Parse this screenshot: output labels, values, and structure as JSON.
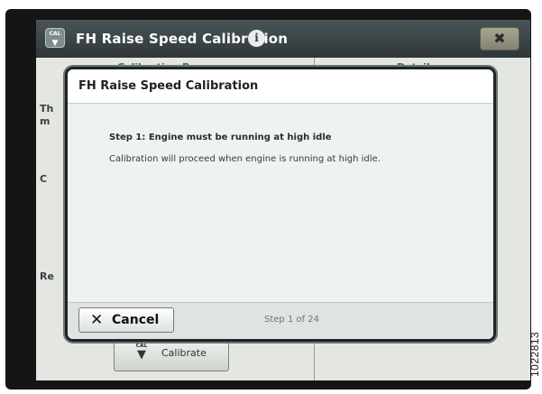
{
  "window": {
    "title": "FH Raise Speed Calibration",
    "app_icon_label": "CAL",
    "icons": {
      "app": "calibrate-icon",
      "info": "info-icon",
      "close": "close-icon"
    },
    "close_label": "✖"
  },
  "background": {
    "columns": [
      "Calibration Process",
      "Details"
    ],
    "left_fragments": [
      "Th",
      "m",
      "C",
      "Re"
    ],
    "calibrate_button": {
      "icon_label": "CAL",
      "label": "Calibrate"
    }
  },
  "dialog": {
    "title": "FH Raise Speed Calibration",
    "step_title": "Step 1: Engine must be running at high idle",
    "step_description": "Calibration will proceed when engine is running at high idle.",
    "cancel_label": "Cancel",
    "cancel_icon": "✕",
    "step_counter": "Step 1 of 24"
  },
  "figure_id": "1022813",
  "colors": {
    "header": "#3b4447",
    "close_button": "#94947e",
    "modal_border": "#1d2326"
  }
}
